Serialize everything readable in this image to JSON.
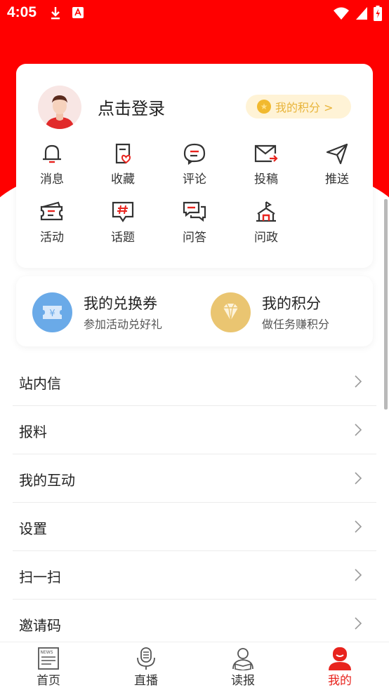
{
  "status_bar": {
    "time": "4:05"
  },
  "profile": {
    "login_text": "点击登录",
    "points_label": "我的积分 >"
  },
  "grid": [
    {
      "label": "消息",
      "icon": "bell-icon"
    },
    {
      "label": "收藏",
      "icon": "favorite-doc-icon"
    },
    {
      "label": "评论",
      "icon": "comment-icon"
    },
    {
      "label": "投稿",
      "icon": "mail-send-icon"
    },
    {
      "label": "推送",
      "icon": "send-arrow-icon"
    },
    {
      "label": "活动",
      "icon": "ticket-icon"
    },
    {
      "label": "话题",
      "icon": "hashtag-icon"
    },
    {
      "label": "问答",
      "icon": "chat-bubbles-icon"
    },
    {
      "label": "问政",
      "icon": "government-building-icon"
    }
  ],
  "coupons": [
    {
      "title": "我的兑换券",
      "subtitle": "参加活动兑好礼",
      "icon": "coupon-icon",
      "color": "#6aaae8"
    },
    {
      "title": "我的积分",
      "subtitle": "做任务赚积分",
      "icon": "diamond-icon",
      "color": "#eac571"
    }
  ],
  "menu": [
    {
      "label": "站内信"
    },
    {
      "label": "报料"
    },
    {
      "label": "我的互动"
    },
    {
      "label": "设置"
    },
    {
      "label": "扫一扫"
    },
    {
      "label": "邀请码"
    }
  ],
  "tabs": [
    {
      "label": "首页",
      "icon": "news-icon",
      "active": false
    },
    {
      "label": "直播",
      "icon": "microphone-icon",
      "active": false
    },
    {
      "label": "读报",
      "icon": "reader-icon",
      "active": false
    },
    {
      "label": "我的",
      "icon": "user-icon",
      "active": true
    }
  ],
  "colors": {
    "primary": "#ff0000",
    "accent": "#e8231d",
    "gold": "#e8b43a"
  }
}
